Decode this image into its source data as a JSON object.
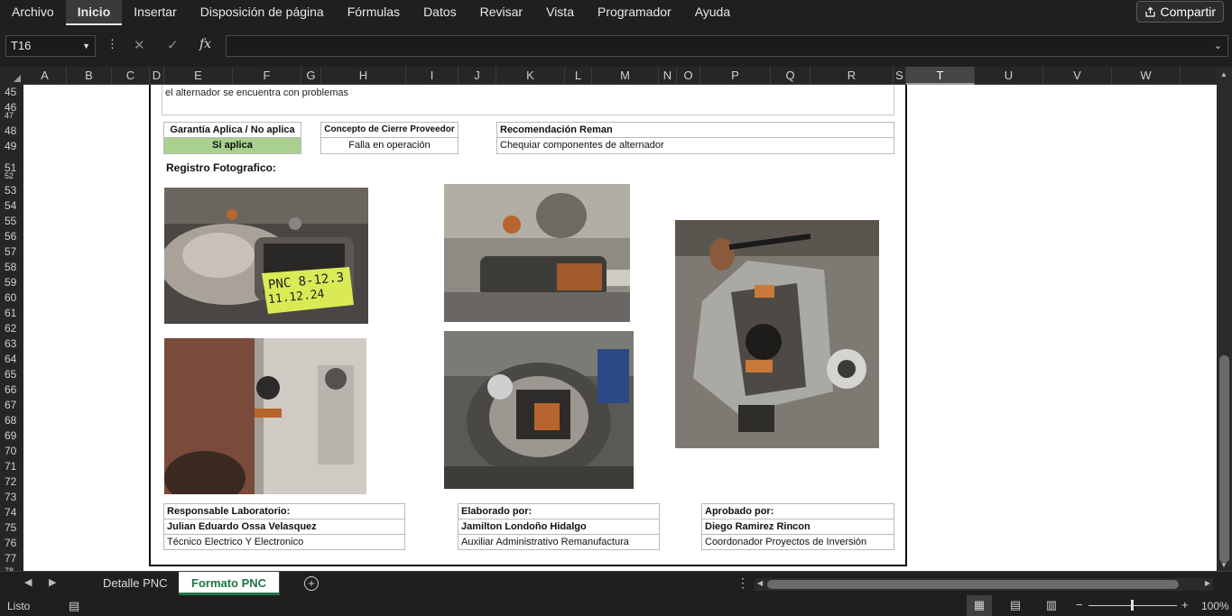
{
  "menu": {
    "items": [
      "Archivo",
      "Inicio",
      "Insertar",
      "Disposición de página",
      "Fórmulas",
      "Datos",
      "Revisar",
      "Vista",
      "Programador",
      "Ayuda"
    ],
    "active": "Inicio",
    "share_label": "Compartir"
  },
  "formula_bar": {
    "namebox": "T16",
    "fx_label": "fx",
    "formula": ""
  },
  "columns": [
    "A",
    "B",
    "C",
    "D",
    "E",
    "F",
    "G",
    "H",
    "I",
    "J",
    "K",
    "L",
    "M",
    "N",
    "O",
    "P",
    "Q",
    "R",
    "S",
    "T",
    "U",
    "V",
    "W"
  ],
  "selected_column": "T",
  "rows": [
    "45",
    "46",
    "47",
    "48",
    "49",
    "51",
    "52",
    "53",
    "54",
    "55",
    "56",
    "57",
    "58",
    "59",
    "60",
    "61",
    "62",
    "63",
    "64",
    "65",
    "66",
    "67",
    "68",
    "69",
    "70",
    "71",
    "72",
    "73",
    "74",
    "75",
    "76",
    "77",
    "78"
  ],
  "sheet": {
    "note_text": "el alternador se encuentra con problemas",
    "warranty": {
      "header": "Garantía Aplica / No aplica",
      "value": "Si aplica"
    },
    "closing_concept": {
      "header": "Concepto de Cierre Proveedor",
      "value": "Falla en operación"
    },
    "recommendation": {
      "header": "Recomendación Reman",
      "value": "Chequiar componentes de alternador"
    },
    "photo_section_label": "Registro Fotografico:",
    "photo1_label_line1": "PNC 8-12.3",
    "photo1_label_line2": "11.12.24",
    "signers": [
      {
        "role": "Responsable Laboratorio:",
        "name": "Julian Eduardo Ossa Velasquez",
        "title": "Técnico Electrico Y Electronico"
      },
      {
        "role": "Elaborado por:",
        "name": "Jamilton Londoño Hidalgo",
        "title": "Auxiliar Administrativo Remanufactura"
      },
      {
        "role": "Aprobado por:",
        "name": "Diego Ramirez Rincon",
        "title": "Coordonador Proyectos de Inversión"
      }
    ]
  },
  "tabs": {
    "items": [
      "Detalle PNC",
      "Formato PNC"
    ],
    "active": "Formato PNC"
  },
  "status": {
    "ready": "Listo",
    "zoom": "100%"
  },
  "colors": {
    "accent": "#217346",
    "green_cell": "#a9d08e"
  }
}
